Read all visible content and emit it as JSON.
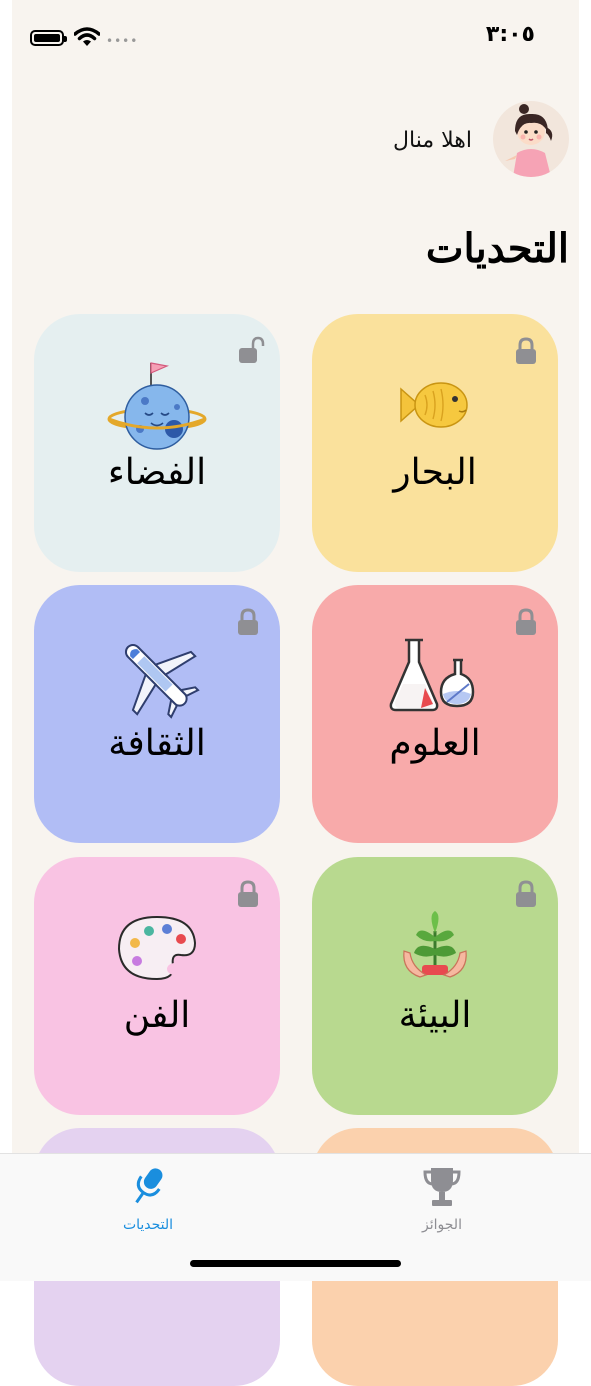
{
  "status_bar": {
    "time": "٣:٠٥"
  },
  "header": {
    "greeting": "اهلا منال",
    "section_title": "التحديات"
  },
  "cards": [
    {
      "label": "البحار",
      "color": "#fae19c",
      "locked": true,
      "icon": "fish-icon"
    },
    {
      "label": "الفضاء",
      "color": "#e5eff0",
      "locked": false,
      "icon": "planet-icon"
    },
    {
      "label": "العلوم",
      "color": "#f8aaaa",
      "locked": true,
      "icon": "flask-icon"
    },
    {
      "label": "الثقافة",
      "color": "#b1bdf5",
      "locked": true,
      "icon": "airplane-icon"
    },
    {
      "label": "البيئة",
      "color": "#b8d98f",
      "locked": true,
      "icon": "plant-hands-icon"
    },
    {
      "label": "الفن",
      "color": "#f9c3e3",
      "locked": true,
      "icon": "palette-icon"
    }
  ],
  "tab_bar": {
    "challenges_label": "التحديات",
    "rewards_label": "الجوائز",
    "active_color": "#1a8ede",
    "inactive_color": "#8e8e93"
  }
}
